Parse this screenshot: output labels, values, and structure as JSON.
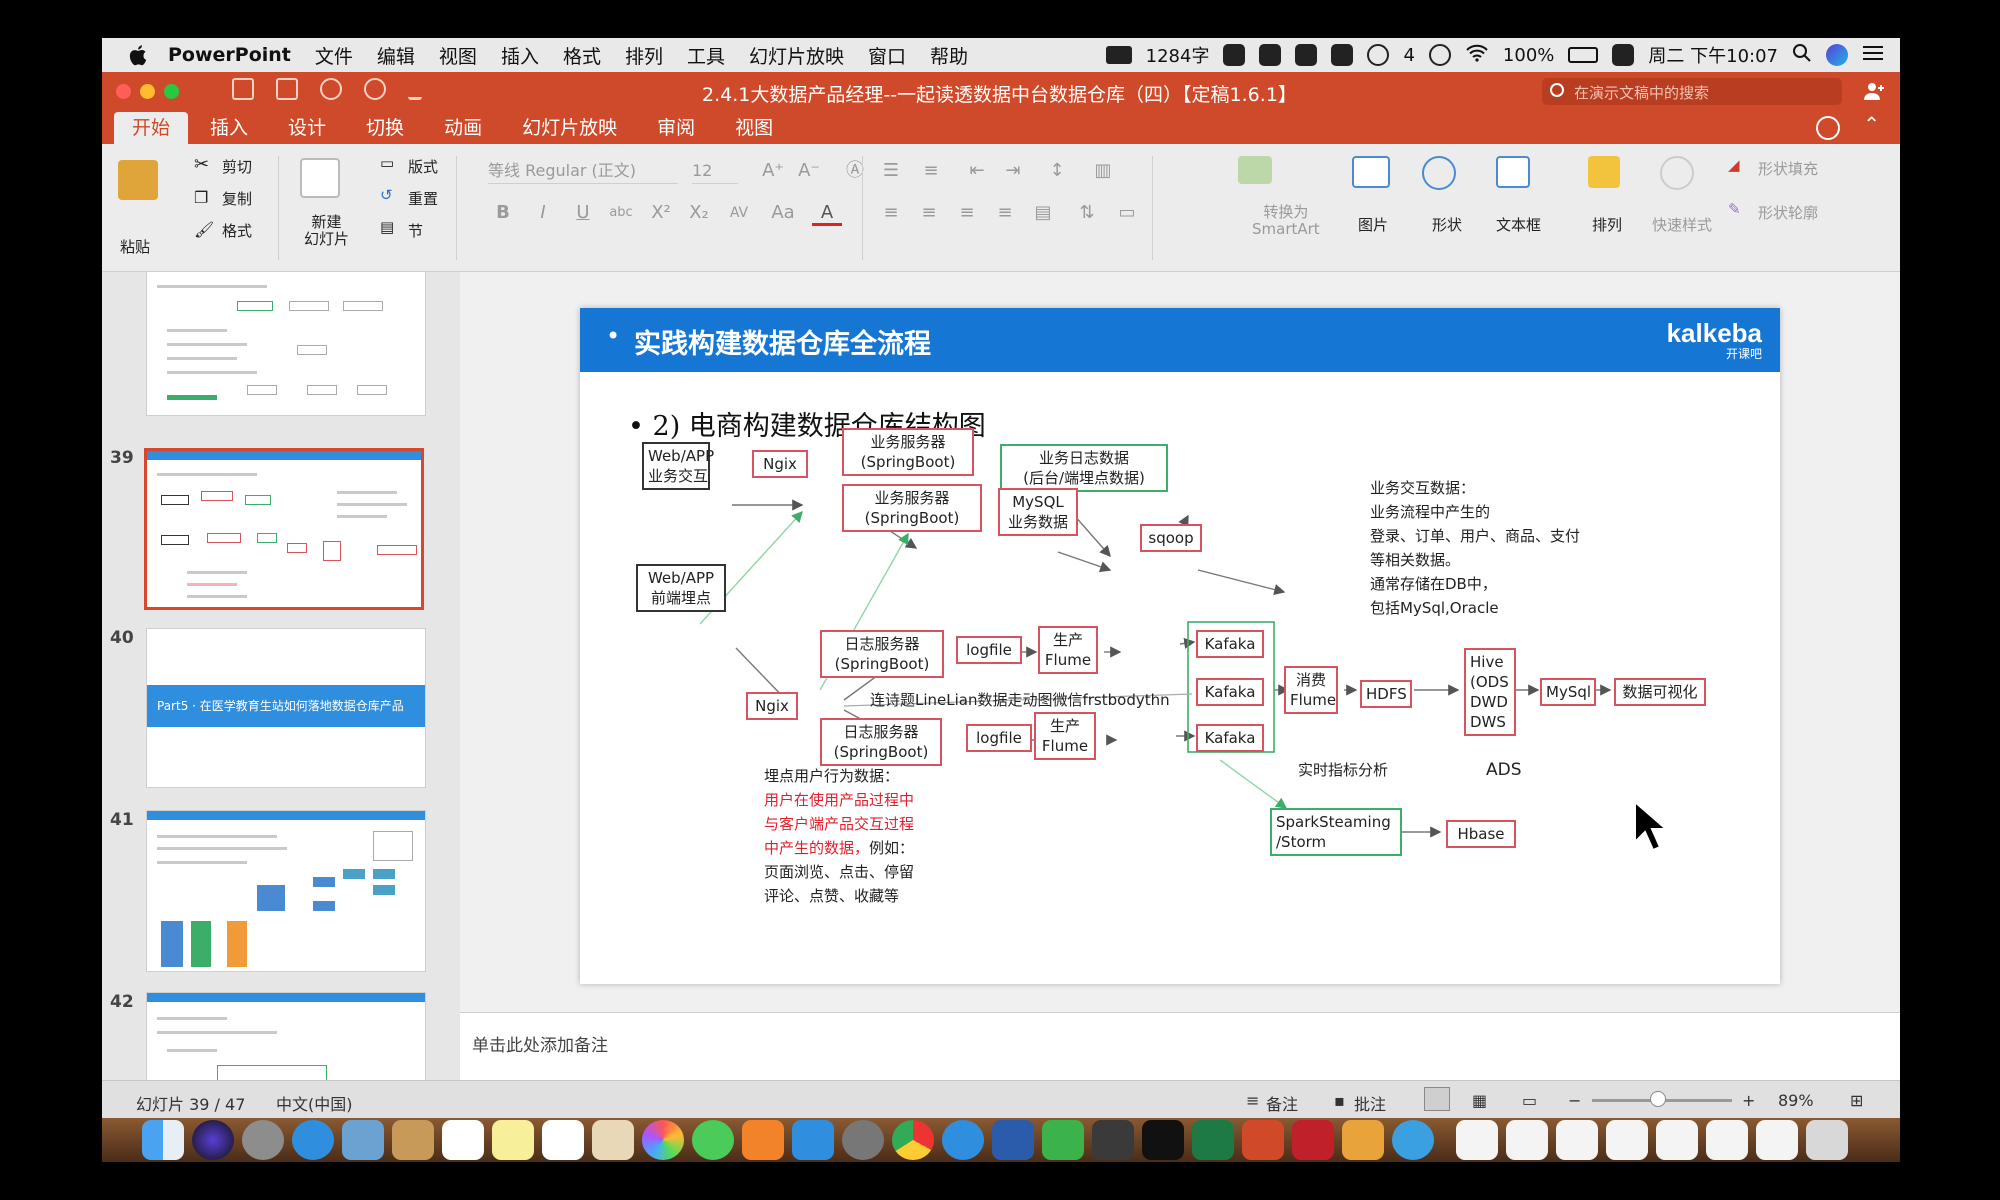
{
  "menubar": {
    "app": "PowerPoint",
    "items": [
      "文件",
      "编辑",
      "视图",
      "插入",
      "格式",
      "排列",
      "工具",
      "幻灯片放映",
      "窗口",
      "帮助"
    ],
    "word_count": "1284字",
    "wechat_count": "4",
    "battery": "100%",
    "clock": "周二 下午10:07"
  },
  "window": {
    "title": "2.4.1大数据产品经理--一起读透数据中台数据仓库（四）【定稿1.6.1】",
    "search_placeholder": "在演示文稿中的搜索"
  },
  "ribbon_tabs": [
    "开始",
    "插入",
    "设计",
    "切换",
    "动画",
    "幻灯片放映",
    "审阅",
    "视图"
  ],
  "ribbon": {
    "paste": "粘贴",
    "cut": "剪切",
    "copy": "复制",
    "format": "格式",
    "new_slide": "新建\n幻灯片",
    "layout": "版式",
    "reset": "重置",
    "section": "节",
    "font_name": "等线 Regular (正文)",
    "font_size": "12",
    "smartart": "转换为\nSmartArt",
    "picture": "图片",
    "shape": "形状",
    "textbox": "文本框",
    "arrange": "排列",
    "quick_styles": "快速样式",
    "shape_fill": "形状填充",
    "shape_outline": "形状轮廓"
  },
  "thumbnails": {
    "n39": "39",
    "n40": "40",
    "n41": "41",
    "n42": "42",
    "t40_text": "Part5 · 在医学教育生站如何落地数据仓库产品"
  },
  "slide": {
    "title": "实践构建数据仓库全流程",
    "logo_brand": "kalkeba",
    "logo_sub": "开课吧",
    "subtitle": "2) 电商构建数据仓库结构图",
    "nodes": {
      "web_app_1": "Web/APP\n业务交互",
      "ngix_1": "Ngix",
      "biz_server_1": "业务服务器\n(SpringBoot)",
      "biz_server_2": "业务服务器\n(SpringBoot)",
      "biz_log": "业务日志数据\n(后台/端埋点数据)",
      "mysql_biz": "MySQL\n业务数据",
      "sqoop": "sqoop",
      "web_app_2": "Web/APP\n前端埋点",
      "ngix_2": "Ngix",
      "log_server_1": "日志服务器\n(SpringBoot)",
      "log_server_2": "日志服务器\n(SpringBoot)",
      "logfile_1": "logfile",
      "logfile_2": "logfile",
      "produce_flume_1": "生产\nFlume",
      "produce_flume_2": "生产\nFlume",
      "kafka_1": "Kafaka",
      "kafka_2": "Kafaka",
      "kafka_3": "Kafaka",
      "consume_flume": "消费\nFlume",
      "hdfs": "HDFS",
      "hive": "Hive\n(ODS\nDWD\nDWS",
      "mysql_out": "MySql",
      "viz": "数据可视化",
      "spark": "SparkSteaming\n/Storm",
      "hbase": "Hbase"
    },
    "ads_label": "ADS",
    "long_link": "连诗题LineLian数据走动图微信frstbodythn",
    "realtime": "实时指标分析",
    "biz_note": [
      "业务交互数据：",
      "业务流程中产生的",
      "登录、订单、用户、商品、支付",
      "等相关数据。",
      "通常存储在DB中，",
      "包括MySql,Oracle"
    ],
    "tracking_note_head": "埋点用户行为数据：",
    "tracking_note_red": [
      "用户在使用产品过程中",
      "与客户端产品交互过程",
      "中产生的数据，"
    ],
    "tracking_note_red_tail": "例如：",
    "tracking_note_tail": [
      "页面浏览、点击、停留",
      "评论、点赞、收藏等"
    ]
  },
  "notes_placeholder": "单击此处添加备注",
  "status": {
    "slide_counter": "幻灯片 39 / 47",
    "language": "中文(中国)",
    "notes": "备注",
    "comments": "批注",
    "zoom": "89%"
  },
  "colors": {
    "accent": "#cf4a2a",
    "slide_header": "#1576d4",
    "node_red": "#d9525f",
    "node_green": "#3cae6a",
    "note_red": "#e0202e"
  }
}
